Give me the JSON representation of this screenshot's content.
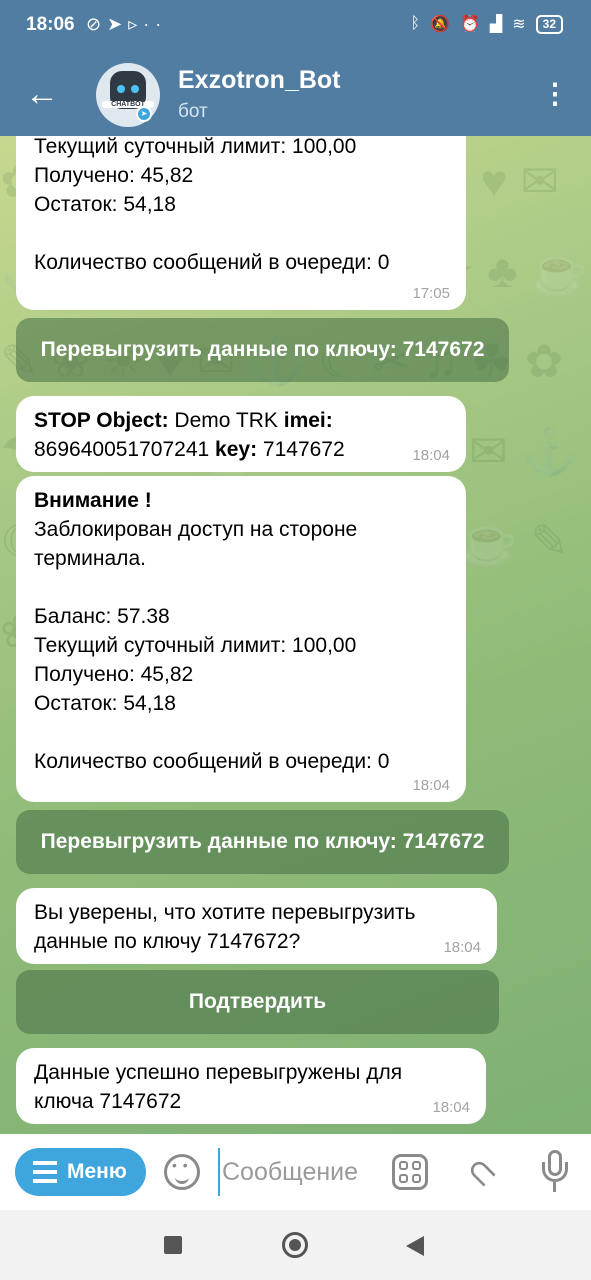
{
  "status_bar": {
    "time": "18:06",
    "left_icons": [
      "vpn-icon",
      "telegram-icon",
      "play-icon",
      "more-icon"
    ],
    "right_icons": [
      "bluetooth-icon",
      "mute-icon",
      "alarm-icon",
      "signal-icon",
      "wifi-icon"
    ],
    "battery": "32"
  },
  "header": {
    "title": "Exzotron_Bot",
    "subtitle": "бот",
    "avatar_text": "CHATBOT",
    "accent": "#517da2"
  },
  "messages": {
    "m1": {
      "lines": [
        "Текущий суточный лимит: 100,00",
        "Получено: 45,82",
        "Остаток: 54,18",
        "",
        "Количество сообщений в очереди: 0"
      ],
      "time": "17:05"
    },
    "kb1": {
      "label": "Перевыгрузить данные по ключу:  7147672"
    },
    "m2": {
      "stop_label": "STOP Object:",
      "object_name": " Demo TRK ",
      "imei_label": " imei:",
      "imei_value": "869640051707241",
      "key_label": " key:",
      "key_value": " 7147672",
      "time": "18:04"
    },
    "m3": {
      "heading": "Внимание !",
      "lines": [
        "Заблокирован доступ на стороне",
        "терминала.",
        "",
        "Баланс: 57.38",
        "Текущий суточный лимит: 100,00",
        "Получено: 45,82",
        "Остаток: 54,18",
        "",
        "Количество сообщений в очереди: 0"
      ],
      "time": "18:04"
    },
    "kb2": {
      "label": "Перевыгрузить данные по ключу:  7147672"
    },
    "m4": {
      "lines": [
        "Вы уверены, что хотите перевыгрузить",
        "данные по ключу 7147672?"
      ],
      "time": "18:04"
    },
    "kb3": {
      "label": "Подтвердить"
    },
    "m5": {
      "lines": [
        "Данные успешно перевыгружены для",
        "ключа 7147672"
      ],
      "time": "18:04"
    }
  },
  "input_bar": {
    "menu_label": "Меню",
    "placeholder": "Сообщение",
    "accent": "#3ea6dd"
  }
}
